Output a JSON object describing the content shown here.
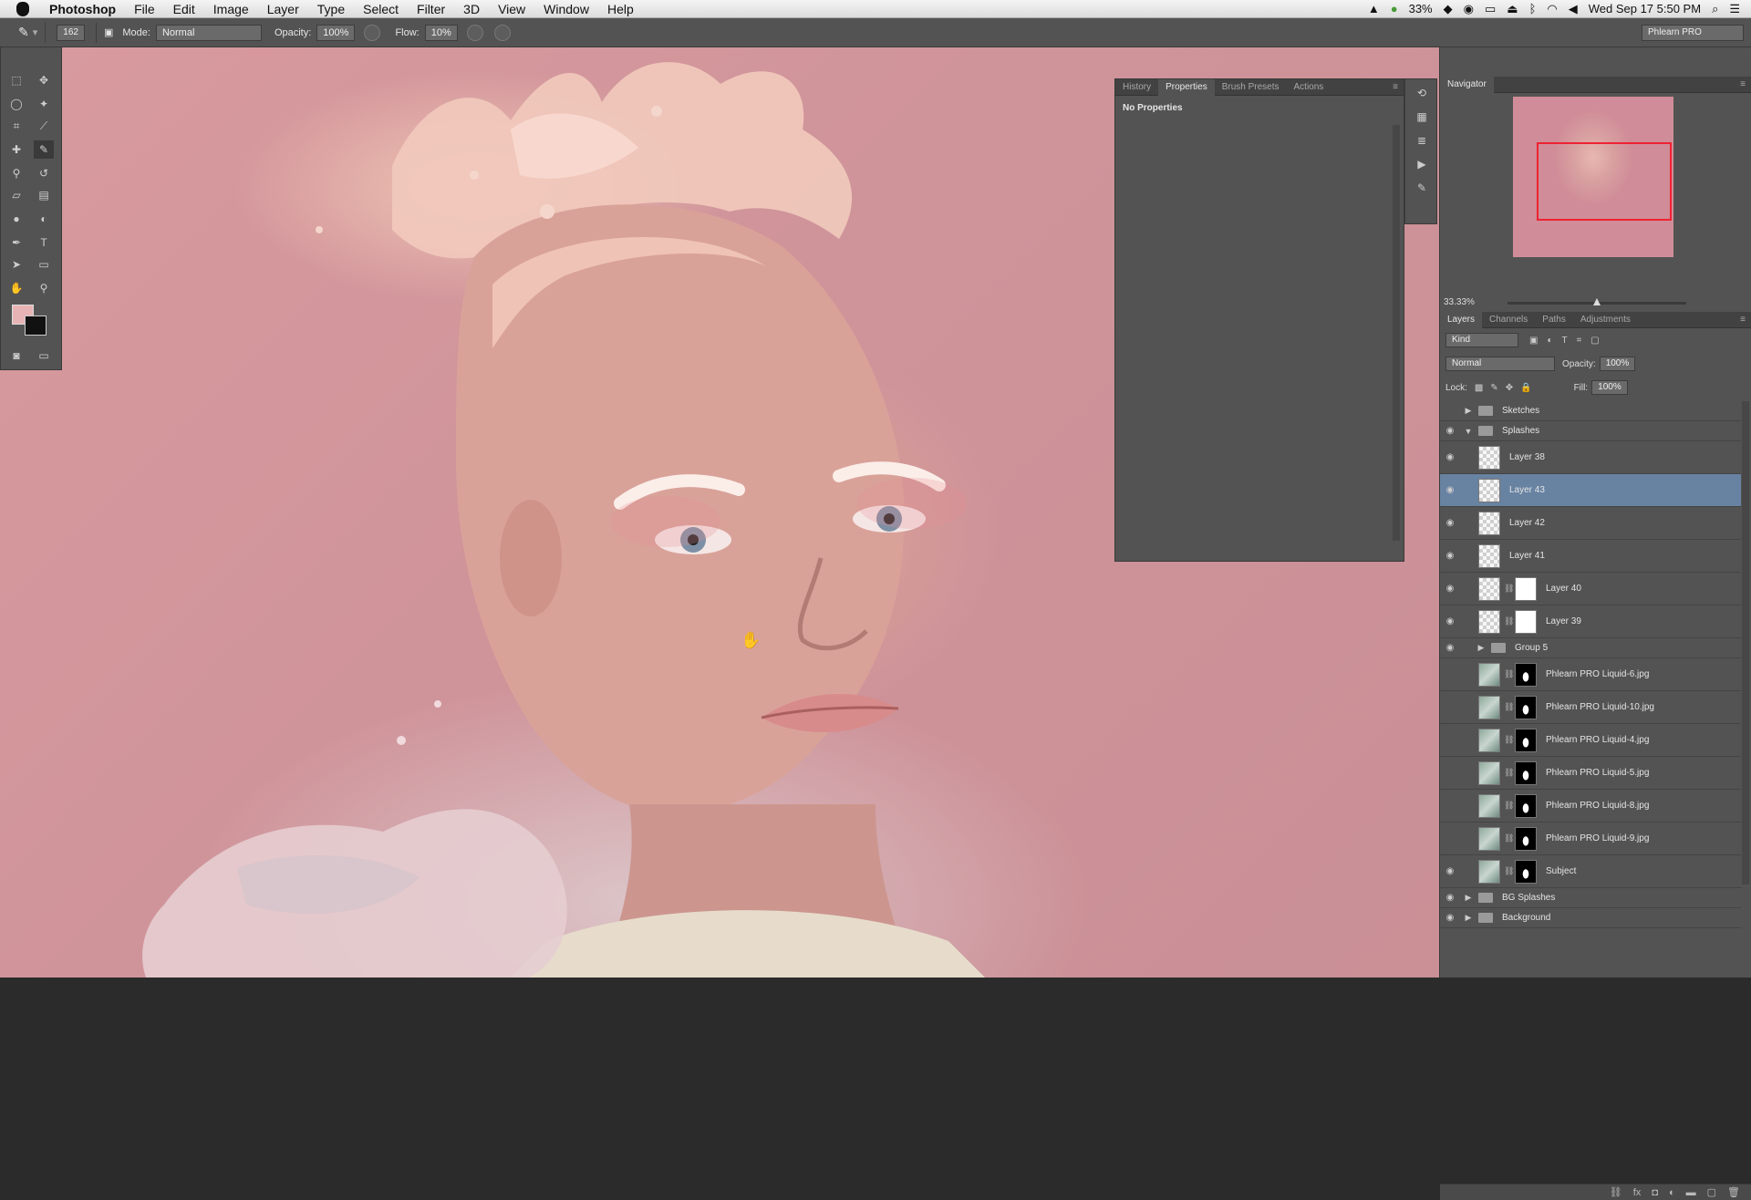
{
  "menubar": {
    "app": "Photoshop",
    "items": [
      "File",
      "Edit",
      "Image",
      "Layer",
      "Type",
      "Select",
      "Filter",
      "3D",
      "View",
      "Window",
      "Help"
    ],
    "battery": "33%",
    "datetime": "Wed Sep 17  5:50 PM"
  },
  "options": {
    "brush_size": "162",
    "mode_label": "Mode:",
    "mode_value": "Normal",
    "opacity_label": "Opacity:",
    "opacity_value": "100%",
    "flow_label": "Flow:",
    "flow_value": "10%",
    "workspace": "Phlearn PRO"
  },
  "properties_panel": {
    "tabs": [
      "History",
      "Properties",
      "Brush Presets",
      "Actions"
    ],
    "active_tab": "Properties",
    "content": "No Properties"
  },
  "navigator": {
    "title": "Navigator",
    "zoom": "33.33%"
  },
  "layers_panel": {
    "tabs": [
      "Layers",
      "Channels",
      "Paths",
      "Adjustments"
    ],
    "kind_label": "Kind",
    "blend_mode": "Normal",
    "opacity_label": "Opacity:",
    "opacity_value": "100%",
    "lock_label": "Lock:",
    "fill_label": "Fill:",
    "fill_value": "100%",
    "layers": [
      {
        "name": "Sketches",
        "type": "group",
        "visible": false,
        "expanded": false,
        "indent": 0
      },
      {
        "name": "Splashes",
        "type": "group",
        "visible": true,
        "expanded": true,
        "indent": 0
      },
      {
        "name": "Layer 38",
        "type": "layer",
        "visible": true,
        "selected": false
      },
      {
        "name": "Layer 43",
        "type": "layer",
        "visible": true,
        "selected": true
      },
      {
        "name": "Layer 42",
        "type": "layer",
        "visible": true,
        "selected": false
      },
      {
        "name": "Layer 41",
        "type": "layer",
        "visible": true,
        "selected": false
      },
      {
        "name": "Layer 40",
        "type": "masked",
        "visible": true,
        "selected": false
      },
      {
        "name": "Layer 39",
        "type": "masked",
        "visible": true,
        "selected": false
      },
      {
        "name": "Group 5",
        "type": "group",
        "visible": true,
        "expanded": false,
        "indent": 1
      },
      {
        "name": "Phlearn PRO Liquid-6.jpg",
        "type": "photo",
        "visible": false
      },
      {
        "name": "Phlearn PRO Liquid-10.jpg",
        "type": "photo",
        "visible": false
      },
      {
        "name": "Phlearn PRO Liquid-4.jpg",
        "type": "photo",
        "visible": false
      },
      {
        "name": "Phlearn PRO Liquid-5.jpg",
        "type": "photo",
        "visible": false
      },
      {
        "name": "Phlearn PRO Liquid-8.jpg",
        "type": "photo",
        "visible": false
      },
      {
        "name": "Phlearn PRO Liquid-9.jpg",
        "type": "photo",
        "visible": false
      },
      {
        "name": "Subject",
        "type": "subject",
        "visible": true
      },
      {
        "name": "BG Splashes",
        "type": "group",
        "visible": true,
        "expanded": false,
        "indent": 0
      },
      {
        "name": "Background",
        "type": "group",
        "visible": true,
        "expanded": false,
        "indent": 0
      }
    ]
  },
  "colors": {
    "ui_panel": "#535353",
    "selected_layer": "#6882a2",
    "foreground_swatch": "#e8b3b4",
    "background_swatch": "#111111",
    "canvas_bg": "#d0959a"
  }
}
